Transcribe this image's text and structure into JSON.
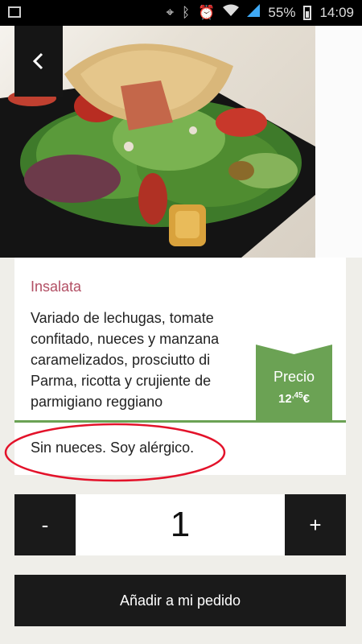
{
  "statusbar": {
    "battery_percent": "55%",
    "time": "14:09",
    "icons": [
      "image-icon",
      "location-icon",
      "bluetooth-icon",
      "alarm-icon",
      "wifi-icon",
      "signal-icon",
      "battery-icon"
    ]
  },
  "navigation": {
    "back_icon": "chevron-left-icon"
  },
  "dish": {
    "category": "Insalata",
    "description": "Variado de lechugas, tomate confitado, nueces y manzana caramelizados, prosciutto di Parma, ricotta y crujiente de parmigiano reggiano",
    "price_label": "Precio",
    "price_main": "12",
    "price_cents": ",45",
    "price_currency": "€",
    "note": "Sin nueces. Soy alérgico."
  },
  "quantity": {
    "minus_label": "-",
    "value": "1",
    "plus_label": "+"
  },
  "actions": {
    "add_label": "Añadir a mi pedido"
  },
  "colors": {
    "category": "#b24f64",
    "accent_green": "#6ba254",
    "dark_button": "#1a1a1a",
    "note_highlight": "#e3122a"
  }
}
